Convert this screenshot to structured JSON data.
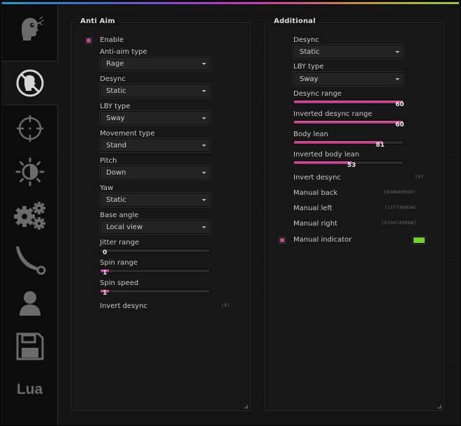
{
  "sidebar": {
    "tabs": [
      {
        "icon": "aimbot-head-icon"
      },
      {
        "icon": "anti-aim-icon",
        "active": true
      },
      {
        "icon": "crosshair-icon"
      },
      {
        "icon": "visuals-brightness-icon"
      },
      {
        "icon": "misc-gears-icon"
      },
      {
        "icon": "skins-knife-icon"
      },
      {
        "icon": "player-list-icon"
      },
      {
        "icon": "config-save-icon"
      },
      {
        "label": "Lua"
      }
    ]
  },
  "anti_aim": {
    "title": "Anti Aim",
    "enable_label": "Enable",
    "anti_aim_type": {
      "label": "Anti-aim type",
      "value": "Rage"
    },
    "desync": {
      "label": "Desync",
      "value": "Static"
    },
    "lby_type": {
      "label": "LBY type",
      "value": "Sway"
    },
    "movement_type": {
      "label": "Movement type",
      "value": "Stand"
    },
    "pitch": {
      "label": "Pitch",
      "value": "Down"
    },
    "yaw": {
      "label": "Yaw",
      "value": "Static"
    },
    "base_angle": {
      "label": "Base angle",
      "value": "Local view"
    },
    "jitter_range": {
      "label": "Jitter range",
      "value": "0",
      "fraction": 0.0
    },
    "spin_range": {
      "label": "Spin range",
      "value": "1",
      "fraction": 0.01
    },
    "spin_speed": {
      "label": "Spin speed",
      "value": "1",
      "fraction": 0.01
    },
    "invert_desync": {
      "label": "Invert desync",
      "key": "[B]"
    }
  },
  "additional": {
    "title": "Additional",
    "desync": {
      "label": "Desync",
      "value": "Static"
    },
    "lby_type": {
      "label": "LBY type",
      "value": "Sway"
    },
    "desync_range": {
      "label": "Desync range",
      "value": "60",
      "fraction": 1.0
    },
    "inverted_desync_range": {
      "label": "Inverted desync range",
      "value": "60",
      "fraction": 1.0
    },
    "body_lean": {
      "label": "Body lean",
      "value": "81",
      "fraction": 0.81
    },
    "inverted_body_lean": {
      "label": "Inverted body lean",
      "value": "53",
      "fraction": 0.53
    },
    "invert_desync": {
      "label": "Invert desync",
      "key": "[B]"
    },
    "manual_back": {
      "label": "Manual back",
      "key": "[DOWNARROW]"
    },
    "manual_left": {
      "label": "Manual left",
      "key": "[LEFTARROW]"
    },
    "manual_right": {
      "label": "Manual right",
      "key": "[RIGHTARROW]"
    },
    "manual_indicator": {
      "label": "Manual indicator",
      "color": "#6fd22a"
    }
  },
  "colors": {
    "accent": "#c2458f",
    "indicator": "#6fd22a"
  }
}
